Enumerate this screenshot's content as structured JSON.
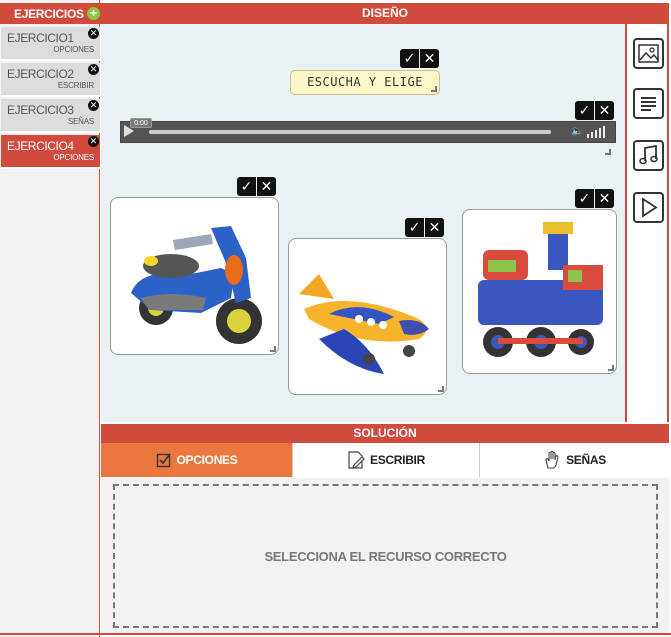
{
  "sidebar": {
    "title": "EJERCICIOS",
    "add_icon": "plus-circle-icon",
    "items": [
      {
        "name": "EJERCICIO1",
        "type": "OPCIONES",
        "active": false
      },
      {
        "name": "EJERCICIO2",
        "type": "ESCRIBIR",
        "active": false
      },
      {
        "name": "EJERCICIO3",
        "type": "SEÑAS",
        "active": false
      },
      {
        "name": "EJERCICIO4",
        "type": "OPCIONES",
        "active": true
      }
    ]
  },
  "design": {
    "header": "DISEÑO",
    "title_text": "ESCUCHA Y ELIGE",
    "player": {
      "time": "0:00"
    },
    "images": [
      {
        "subject": "scooter"
      },
      {
        "subject": "airplane"
      },
      {
        "subject": "train"
      }
    ],
    "tools": [
      "image-icon",
      "text-icon",
      "music-icon",
      "video-play-icon"
    ]
  },
  "solution": {
    "header": "SOLUCIÓN",
    "tabs": [
      {
        "label": "OPCIONES",
        "icon": "checkbox-icon",
        "active": true
      },
      {
        "label": "ESCRIBIR",
        "icon": "pencil-icon",
        "active": false
      },
      {
        "label": "SEÑAS",
        "icon": "hand-icon",
        "active": false
      }
    ],
    "placeholder": "SELECCIONA EL RECURSO CORRECTO"
  },
  "colors": {
    "accent": "#d04a3e",
    "active_tab": "#e9773e",
    "canvas_bg": "#e9f1f2",
    "add_button": "#8cc63f"
  }
}
